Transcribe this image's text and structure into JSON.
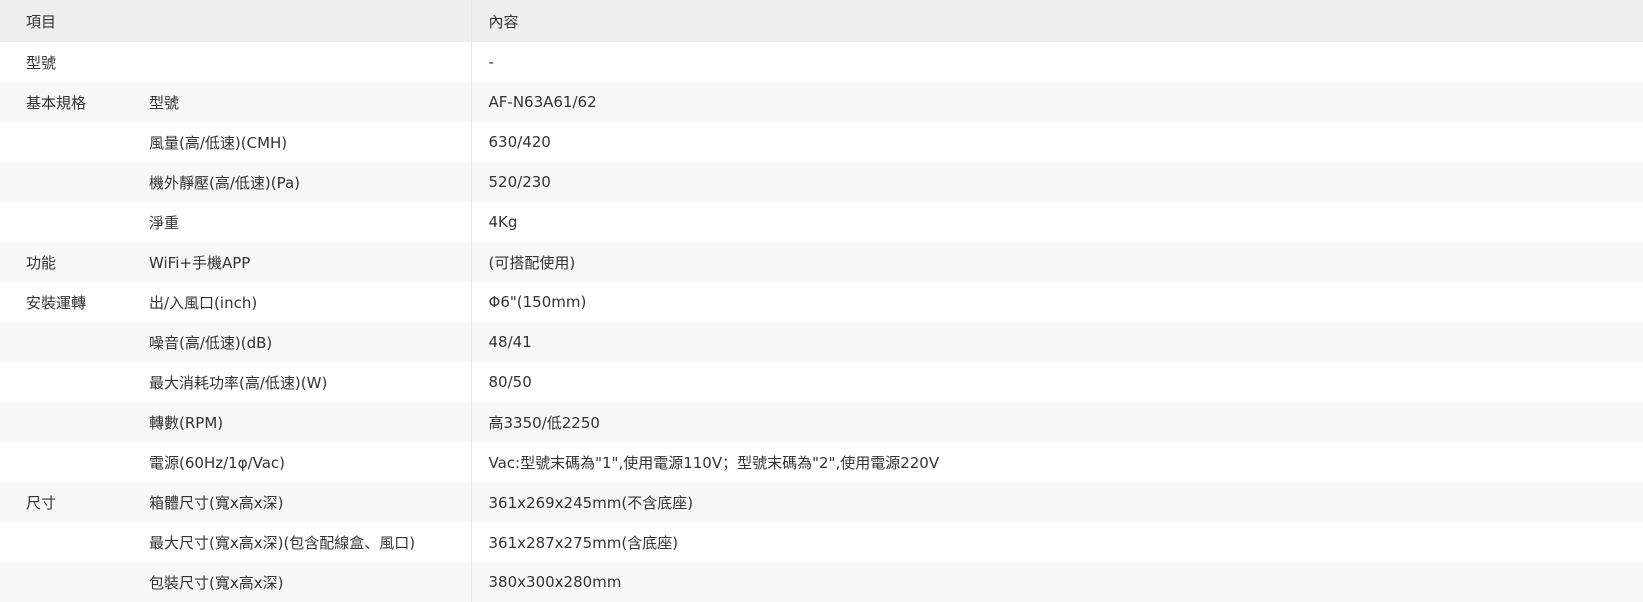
{
  "header": {
    "col_item": "項目",
    "col_content": "內容"
  },
  "rows": [
    {
      "category": "型號",
      "item": "",
      "value": "-"
    },
    {
      "category": "基本規格",
      "item": "型號",
      "value": "AF-N63A61/62"
    },
    {
      "category": "",
      "item": "風量(高/低速)(CMH)",
      "value": "630/420"
    },
    {
      "category": "",
      "item": "機外靜壓(高/低速)(Pa)",
      "value": "520/230"
    },
    {
      "category": "",
      "item": "淨重",
      "value": "4Kg"
    },
    {
      "category": "功能",
      "item": "WiFi+手機APP",
      "value": "(可搭配使用)"
    },
    {
      "category": "安裝運轉",
      "item": "出/入風口(inch)",
      "value": "Φ6\"(150mm)"
    },
    {
      "category": "",
      "item": "噪音(高/低速)(dB)",
      "value": "48/41"
    },
    {
      "category": "",
      "item": "最大消耗功率(高/低速)(W)",
      "value": "80/50"
    },
    {
      "category": "",
      "item": "轉數(RPM)",
      "value": "高3350/低2250"
    },
    {
      "category": "",
      "item": "電源(60Hz/1φ/Vac)",
      "value": "Vac:型號末碼為\"1\",使用電源110V；型號末碼為\"2\",使用電源220V"
    },
    {
      "category": "尺寸",
      "item": "箱體尺寸(寬x高x深)",
      "value": "361x269x245mm(不含底座)"
    },
    {
      "category": "",
      "item": "最大尺寸(寬x高x深)(包含配線盒、風口)",
      "value": "361x287x275mm(含底座)"
    },
    {
      "category": "",
      "item": "包裝尺寸(寬x高x深)",
      "value": "380x300x280mm"
    }
  ]
}
